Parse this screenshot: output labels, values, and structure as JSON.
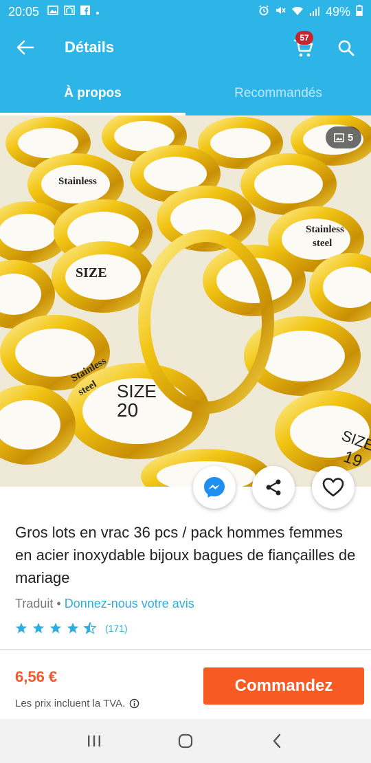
{
  "status_bar": {
    "time": "20:05",
    "battery": "49%"
  },
  "app_bar": {
    "title": "Détails",
    "cart_count": "57"
  },
  "tabs": [
    {
      "label": "À propos",
      "active": true
    },
    {
      "label": "Recommandés",
      "active": false
    }
  ],
  "gallery": {
    "image_count": "5"
  },
  "product": {
    "title": "Gros lots en vrac 36 pcs / pack hommes femmes en acier inoxydable bijoux bagues de fiançailles de mariage",
    "translated": "Traduit",
    "separator": "•",
    "feedback_link": "Donnez-nous votre avis",
    "rating": 4.5,
    "rating_count": "(171)"
  },
  "purchase": {
    "price": "6,56 €",
    "vat_note": "Les prix incluent la TVA.",
    "order_label": "Commandez"
  },
  "colors": {
    "primary": "#2eb5e8",
    "accent": "#f85a24",
    "badge": "#c4262e",
    "link": "#2eaee0"
  },
  "icons": {
    "back": "arrow-left-icon",
    "cart": "shopping-cart-icon",
    "search": "search-icon",
    "gallery": "image-icon",
    "messenger": "messenger-icon",
    "share": "share-icon",
    "wishlist": "heart-icon",
    "info": "info-icon"
  }
}
